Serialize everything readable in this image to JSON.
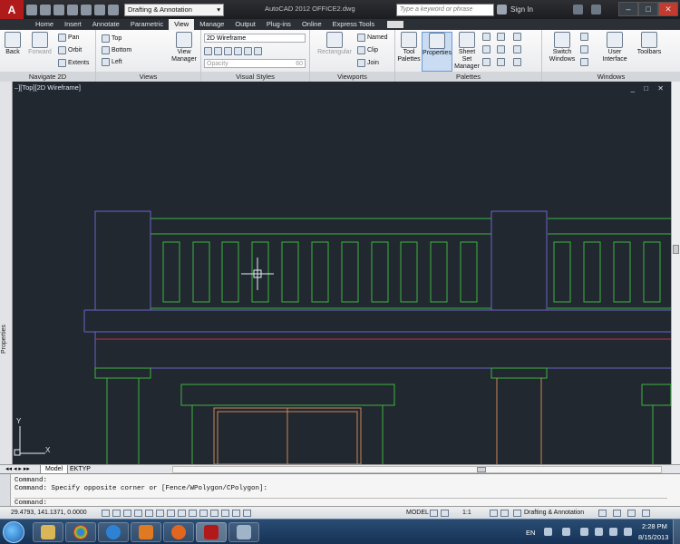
{
  "titlebar": {
    "app_logo": "A",
    "workspace": "Drafting & Annotation",
    "title": "AutoCAD 2012    OFFICE2.dwg",
    "search_placeholder": "Type a keyword or phrase",
    "signin": "Sign In",
    "min": "–",
    "max": "□",
    "close": "✕"
  },
  "tabs": [
    "Home",
    "Insert",
    "Annotate",
    "Parametric",
    "View",
    "Manage",
    "Output",
    "Plug-ins",
    "Online",
    "Express Tools"
  ],
  "active_tab": "View",
  "ribbon": {
    "navigate": {
      "title": "Navigate 2D",
      "back": "Back",
      "forward": "Forward",
      "pan": "Pan",
      "orbit": "Orbit",
      "extents": "Extents"
    },
    "views": {
      "title": "Views",
      "top": "Top",
      "bottom": "Bottom",
      "left": "Left",
      "view_manager": "View Manager"
    },
    "visual_styles": {
      "title": "Visual Styles",
      "current": "2D Wireframe",
      "opacity": "Opacity",
      "opacity_value": "60"
    },
    "viewports": {
      "title": "Viewports",
      "rectangular": "Rectangular",
      "named": "Named",
      "clip": "Clip",
      "join": "Join"
    },
    "palettes": {
      "title": "Palettes",
      "tool_palettes": "Tool Palettes",
      "properties": "Properties",
      "sheet_set": "Sheet Set Manager"
    },
    "windows": {
      "title": "Windows",
      "switch_windows": "Switch Windows",
      "user_interface": "User Interface",
      "toolbars": "Toolbars"
    }
  },
  "viewport": {
    "label": "–][Top][2D Wireframe]",
    "controls": "_ □ ✕",
    "ucs_x": "X",
    "ucs_y": "Y"
  },
  "palette_strip": {
    "label": "Properties"
  },
  "layout_tabs": [
    "Model",
    "EKTYP"
  ],
  "active_layout": "Model",
  "command": {
    "line1": "Command:",
    "line2": "Command: Specify opposite corner or [Fence/WPolygon/CPolygon]:",
    "prompt": "Command:"
  },
  "status": {
    "coords": "29.4793, 141.1371, 0.0000",
    "model": "MODEL",
    "scale": "1:1",
    "workspace": "Drafting & Annotation"
  },
  "taskbar": {
    "lang": "EN",
    "time": "2:28 PM",
    "date": "8/15/2013"
  },
  "colors": {
    "viewport_bg": "#212830",
    "green_line": "#3fb33f",
    "blue_line": "#6a62c8",
    "red_line": "#c0324a",
    "orange_line": "#c8885a"
  }
}
